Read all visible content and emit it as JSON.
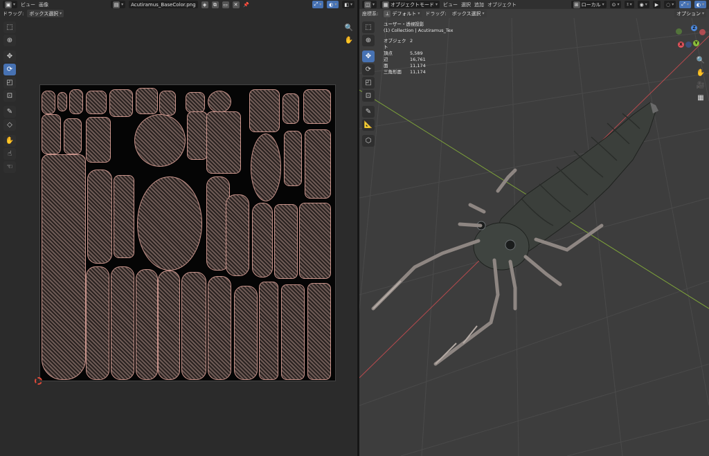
{
  "uv_editor": {
    "header": {
      "menus": [
        "ビュー",
        "画像"
      ],
      "image_name": "Acutiramus_BaseColor.png"
    },
    "drag_row": {
      "label": "ドラッグ:",
      "value": "ボックス選択"
    },
    "tools": [
      {
        "icon": "select-box-icon",
        "active": false
      },
      {
        "icon": "cursor-icon",
        "active": false
      },
      {
        "icon": "move-icon",
        "active": false
      },
      {
        "icon": "rotate-icon",
        "active": true
      },
      {
        "icon": "scale-icon",
        "active": false
      },
      {
        "icon": "transform-icon",
        "active": false
      },
      {
        "icon": "annotate-icon",
        "active": false
      },
      {
        "icon": "rip-icon",
        "active": false
      },
      {
        "icon": "grab-icon",
        "active": false
      },
      {
        "icon": "relax-icon",
        "active": false
      },
      {
        "icon": "pinch-icon",
        "active": false
      }
    ]
  },
  "viewport": {
    "header": {
      "mode": "オブジェクトモード",
      "menus": [
        "ビュー",
        "選択",
        "追加",
        "オブジェクト"
      ],
      "transform_orientation": "ローカル",
      "options_label": "オプション"
    },
    "toolrow": {
      "coord_label": "座標系:",
      "coord_value": "デフォルト",
      "drag_label": "ドラッグ:",
      "drag_value": "ボックス選択"
    },
    "overlay": {
      "view_name": "ユーザー・透視投影",
      "collection": "(1) Collection | Acutiramus_Tex",
      "stats": [
        {
          "label": "オブジェクト",
          "value": "2"
        },
        {
          "label": "頂点",
          "value": "5,589"
        },
        {
          "label": "辺",
          "value": "16,761"
        },
        {
          "label": "面",
          "value": "11,174"
        },
        {
          "label": "三角形面",
          "value": "11,174"
        }
      ]
    },
    "gizmo": {
      "x": "X",
      "y": "Y",
      "z": "Z"
    },
    "tools": [
      {
        "icon": "select-box-icon",
        "active": false
      },
      {
        "icon": "cursor-icon",
        "active": false
      },
      {
        "icon": "move-icon",
        "active": true
      },
      {
        "icon": "rotate-icon",
        "active": false
      },
      {
        "icon": "scale-icon",
        "active": false
      },
      {
        "icon": "transform-icon",
        "active": false
      },
      {
        "icon": "annotate-icon",
        "active": false
      },
      {
        "icon": "measure-icon",
        "active": false
      },
      {
        "icon": "add-cube-icon",
        "active": false
      }
    ]
  },
  "colors": {
    "accent": "#4772b3",
    "x_axis": "#e0525a",
    "y_axis": "#8bbf3a",
    "z_axis": "#4d8ae0",
    "uv_wire": "#c8938a"
  }
}
